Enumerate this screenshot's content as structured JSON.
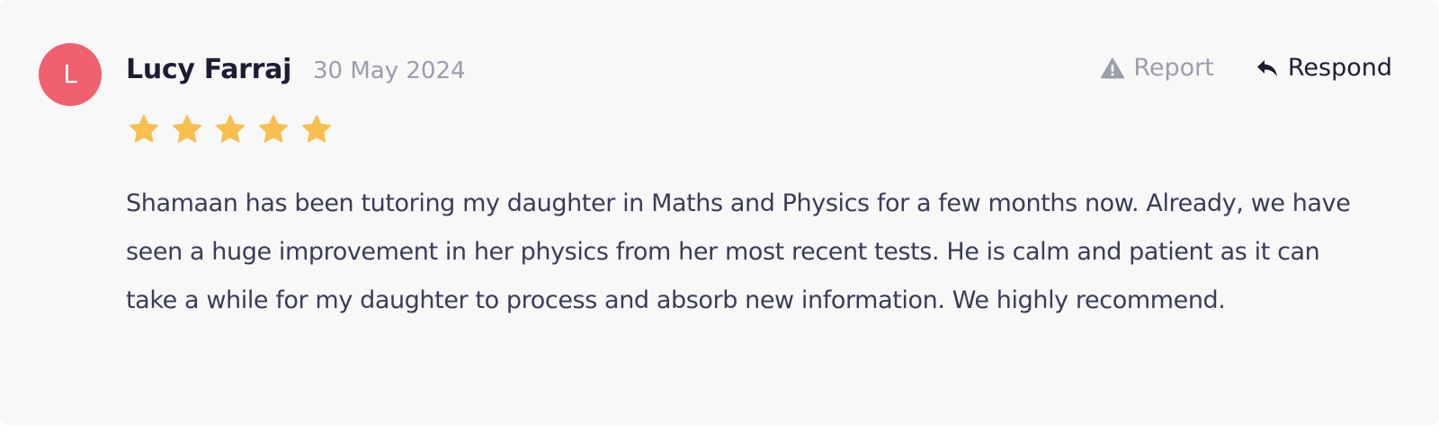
{
  "review": {
    "avatar_initial": "L",
    "reviewer_name": "Lucy Farraj",
    "date": "30 May 2024",
    "rating": 5,
    "rating_max": 5,
    "text": "Shamaan has been tutoring my daughter in Maths and Physics for a few months now. Already, we have seen a huge improvement in her physics from her most recent tests. He is calm and patient as it can take a while for my daughter to process and absorb new information. We highly recommend."
  },
  "actions": {
    "report_label": "Report",
    "report_icon": "warning-triangle-icon",
    "respond_label": "Respond",
    "respond_icon": "reply-arrow-icon"
  },
  "colors": {
    "avatar_bg": "#f0606f",
    "star": "#f6bf4f",
    "name": "#1c1d35",
    "muted": "#9b9eab",
    "body_text": "#3a3c58",
    "card_bg": "#f8f8f9"
  }
}
